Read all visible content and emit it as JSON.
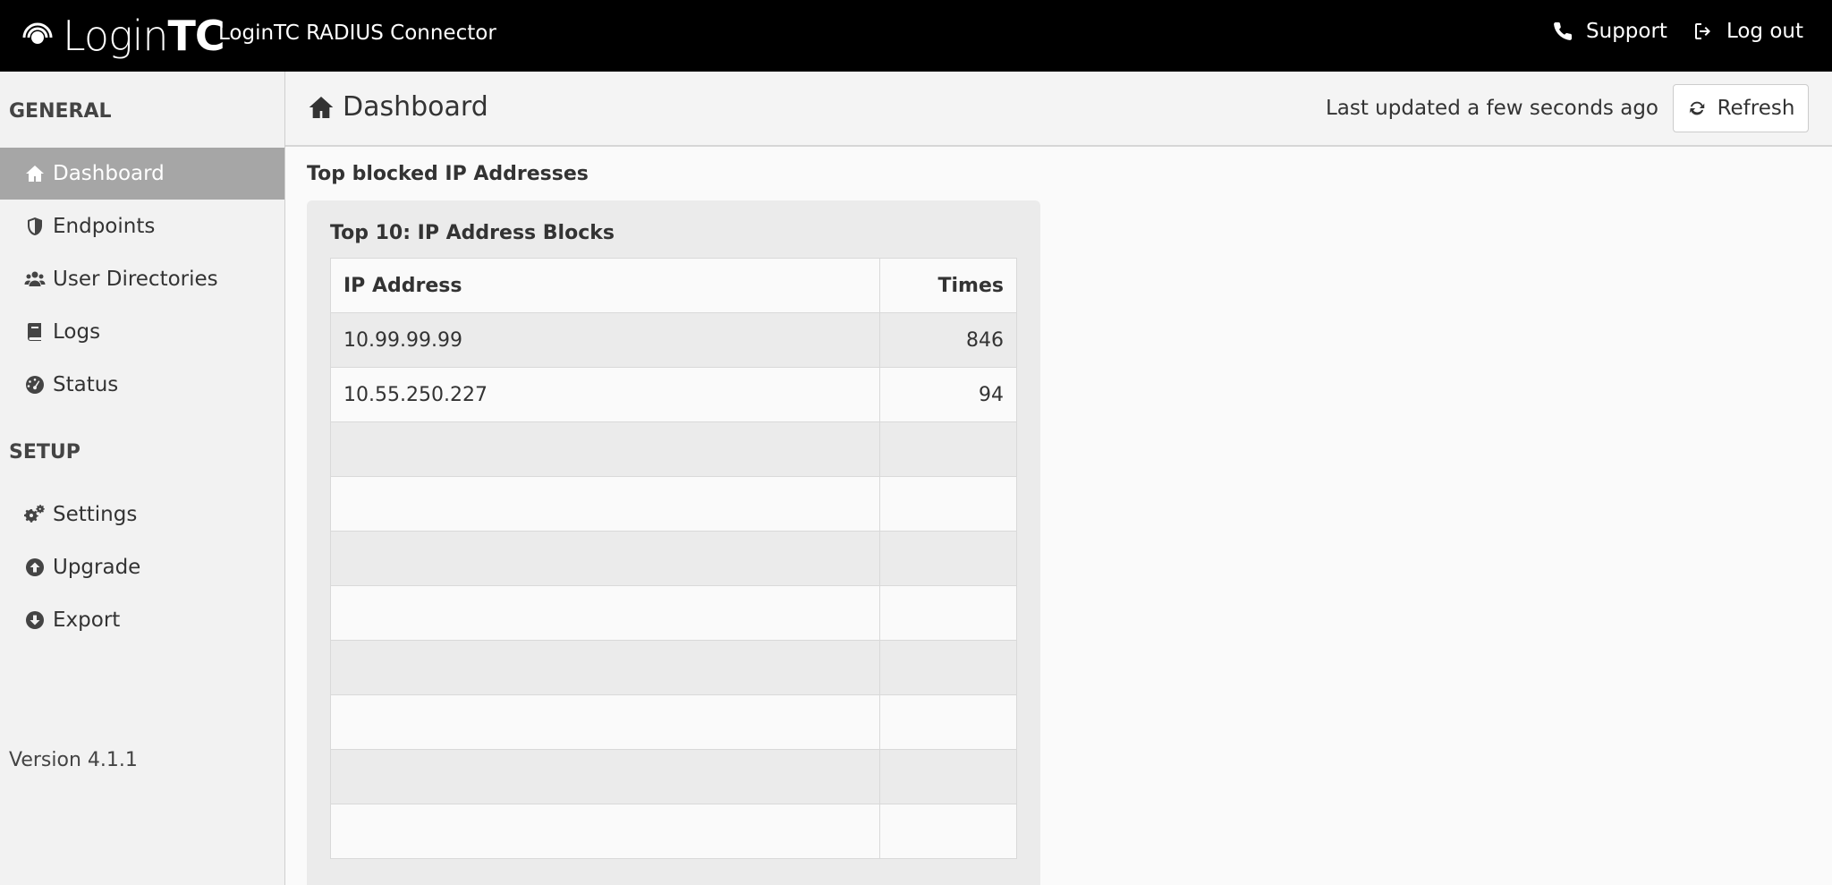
{
  "header": {
    "brand_light": "Login",
    "brand_bold": "TC",
    "app_title": "LoginTC RADIUS Connector",
    "support_label": "Support",
    "logout_label": "Log out"
  },
  "sidebar": {
    "general_heading": "GENERAL",
    "setup_heading": "SETUP",
    "items": [
      {
        "label": "Dashboard",
        "icon": "home-icon",
        "active": true
      },
      {
        "label": "Endpoints",
        "icon": "shield-icon"
      },
      {
        "label": "User Directories",
        "icon": "users-icon"
      },
      {
        "label": "Logs",
        "icon": "book-icon"
      },
      {
        "label": "Status",
        "icon": "gauge-icon"
      },
      {
        "label": "Settings",
        "icon": "gears-icon"
      },
      {
        "label": "Upgrade",
        "icon": "arrow-up-circle-icon"
      },
      {
        "label": "Export",
        "icon": "arrow-down-circle-icon"
      }
    ],
    "version": "Version 4.1.1"
  },
  "main": {
    "page_title": "Dashboard",
    "last_updated": "Last updated a few seconds ago",
    "refresh_label": "Refresh",
    "section_title": "Top blocked IP Addresses",
    "panel_title": "Top 10: IP Address Blocks",
    "table": {
      "columns": [
        "IP Address",
        "Times"
      ],
      "rows": [
        [
          "10.99.99.99",
          "846"
        ],
        [
          "10.55.250.227",
          "94"
        ],
        [
          "",
          ""
        ],
        [
          "",
          ""
        ],
        [
          "",
          ""
        ],
        [
          "",
          ""
        ],
        [
          "",
          ""
        ],
        [
          "",
          ""
        ],
        [
          "",
          ""
        ],
        [
          "",
          ""
        ]
      ]
    }
  },
  "colors": {
    "topbar": "#000000",
    "sidebar_active": "#a6a6a6",
    "sidebar_bg": "#f2f2f2"
  }
}
